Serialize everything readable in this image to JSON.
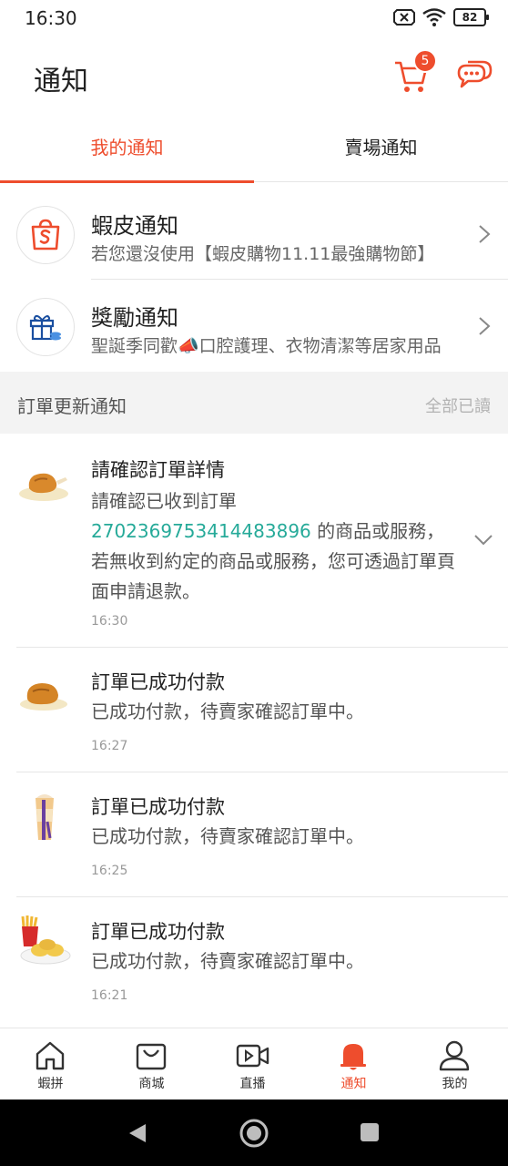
{
  "status_bar": {
    "time": "16:30",
    "battery": "82"
  },
  "header": {
    "title": "通知",
    "cart_badge": "5",
    "icons": [
      "cart-icon",
      "chat-icon"
    ]
  },
  "tabs": [
    {
      "label": "我的通知",
      "active": true
    },
    {
      "label": "賣場通知",
      "active": false
    }
  ],
  "system_notices": [
    {
      "title": "蝦皮通知",
      "desc": "若您還沒使用【蝦皮購物11.11最強購物節】",
      "icon": "shopee-bag-icon"
    },
    {
      "title": "獎勵通知",
      "desc": "聖誕季同歡📣口腔護理、衣物清潔等居家用品",
      "icon": "gift-icon"
    }
  ],
  "order_section": {
    "title": "訂單更新通知",
    "mark_all_read": "全部已讀"
  },
  "orders": [
    {
      "title": "請確認訂單詳情",
      "body_line1": "請確認已收到訂單",
      "order_no": "2702369753414483896",
      "body_rest": " 的商品或服務，若無收到約定的商品或服務，您可透過訂單頁面申請退款。",
      "time": "16:30",
      "thumb": "fried-chicken"
    },
    {
      "title": "訂單已成功付款",
      "body": "已成功付款，待賣家確認訂單中。",
      "time": "16:27",
      "thumb": "fried-chicken"
    },
    {
      "title": "訂單已成功付款",
      "body": "已成功付款，待賣家確認訂單中。",
      "time": "16:25",
      "thumb": "drink-cup"
    },
    {
      "title": "訂單已成功付款",
      "body": "已成功付款，待賣家確認訂單中。",
      "time": "16:21",
      "thumb": "fries-combo"
    }
  ],
  "bottom_nav": [
    {
      "label": "蝦拼",
      "icon": "house-icon",
      "active": false
    },
    {
      "label": "商城",
      "icon": "mall-bag-icon",
      "active": false
    },
    {
      "label": "直播",
      "icon": "video-icon",
      "active": false
    },
    {
      "label": "通知",
      "icon": "bell-icon",
      "active": true
    },
    {
      "label": "我的",
      "icon": "person-icon",
      "active": false
    }
  ],
  "colors": {
    "accent": "#ee4d2d",
    "link": "#26aa99",
    "section_bg": "#f3f3f3"
  }
}
